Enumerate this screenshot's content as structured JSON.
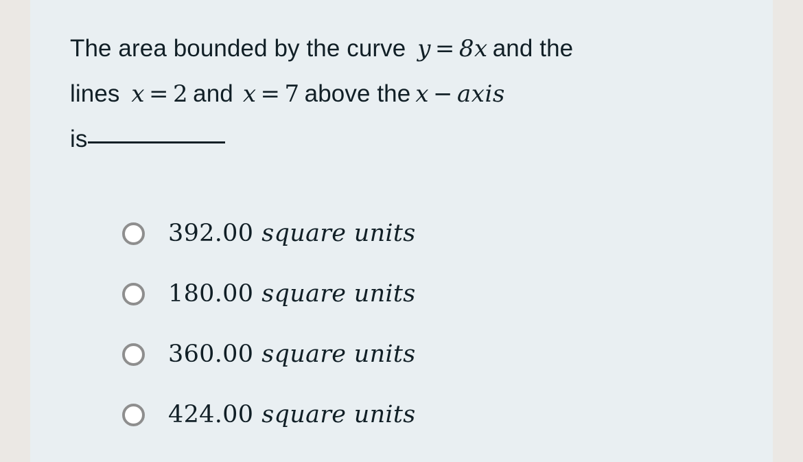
{
  "colors": {
    "page_margin": "#ebe8e4",
    "content_background": "#e9eff2",
    "text": "#111f26",
    "radio_ring": "#8e8e8e",
    "radio_fill": "#ffffff"
  },
  "question": {
    "line1": {
      "text_before": "The area bounded by the curve",
      "math": "y = 8x",
      "math_var": "y",
      "math_op": "=",
      "math_expr": "8x",
      "text_after": "and the"
    },
    "line2": {
      "text_before": "lines",
      "math1_var": "x",
      "math1_op": "=",
      "math1_value": "2",
      "text_middle": "and",
      "math2_var": "x",
      "math2_op": "=",
      "math2_value": "7",
      "text_after": "above the",
      "math3": "x − axis",
      "math3_var": "x",
      "math3_op": "−",
      "math3_word": "axis"
    },
    "line3": {
      "text": "is",
      "blank": "__________"
    },
    "full_text": "The area bounded by the curve y = 8x and the lines x = 2 and x = 7 above the x − axis is__________"
  },
  "options": [
    {
      "id": "option-a",
      "value": "392.00",
      "unit": "square units",
      "selected": false
    },
    {
      "id": "option-b",
      "value": "180.00",
      "unit": "square units",
      "selected": false
    },
    {
      "id": "option-c",
      "value": "360.00",
      "unit": "square units",
      "selected": false
    },
    {
      "id": "option-d",
      "value": "424.00",
      "unit": "square units",
      "selected": false
    }
  ]
}
